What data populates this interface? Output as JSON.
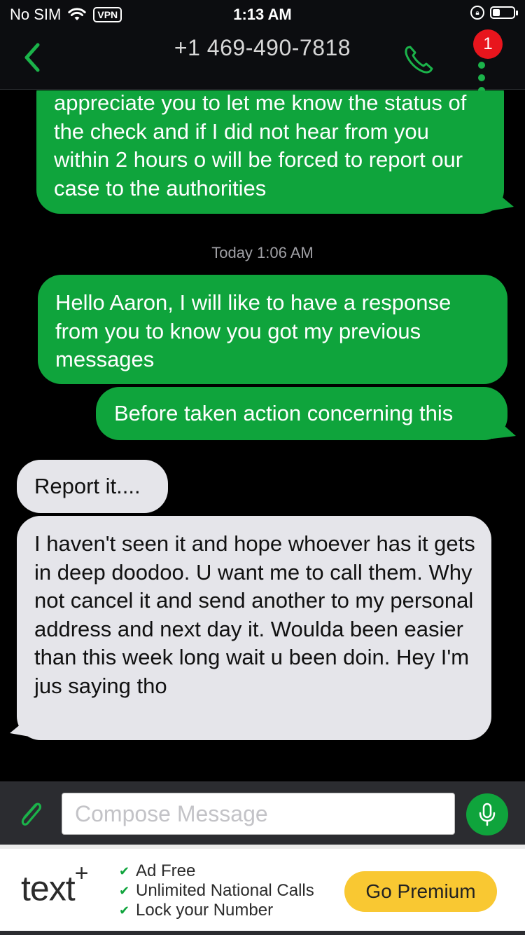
{
  "status_bar": {
    "carrier": "No SIM",
    "vpn": "VPN",
    "time": "1:13 AM"
  },
  "header": {
    "title": "+1 469-490-7818",
    "badge_count": "1"
  },
  "messages": [
    {
      "direction": "outgoing",
      "text": "appreciate you to let me know the status of the check and if I did not hear from you within 2 hours o will be forced to report our case to the authorities"
    },
    {
      "direction": "outgoing",
      "text": "Hello Aaron, I will like to have a response from you to know you got my previous messages"
    },
    {
      "direction": "outgoing",
      "text": "Before taken action concerning this"
    },
    {
      "direction": "incoming",
      "text": "Report it...."
    },
    {
      "direction": "incoming",
      "text": "I haven't seen it and hope whoever has it gets in deep doodoo. U want me to call them. Why not cancel it and send another to my personal address and next day it. Woulda been easier than this week long wait u been doin. Hey I'm jus saying tho"
    }
  ],
  "timestamp": "Today 1:06 AM",
  "compose": {
    "placeholder": "Compose Message",
    "value": ""
  },
  "ad": {
    "logo_text": "text",
    "logo_plus": "+",
    "features": [
      "Ad Free",
      "Unlimited National Calls",
      "Lock your Number"
    ],
    "cta": "Go Premium"
  },
  "colors": {
    "accent_green": "#0fa43c",
    "incoming_bubble": "#e5e5ea",
    "badge_red": "#e8151d",
    "premium_yellow": "#f9c832"
  },
  "icons": {
    "back": "chevron-left-icon",
    "call": "phone-icon",
    "menu": "vertical-dots-icon",
    "attach": "paperclip-icon",
    "mic": "microphone-icon",
    "wifi": "wifi-icon",
    "battery": "battery-icon",
    "rotation_lock": "rotation-lock-icon"
  }
}
